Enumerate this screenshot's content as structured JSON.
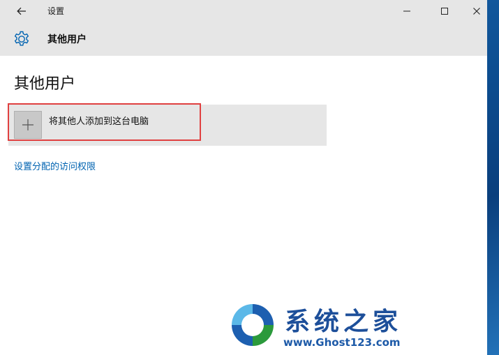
{
  "window": {
    "title": "设置"
  },
  "header": {
    "title": "其他用户"
  },
  "main": {
    "page_title": "其他用户",
    "add_user_label": "将其他人添加到这台电脑",
    "access_link": "设置分配的访问权限"
  },
  "watermark": {
    "brand": "系统之家",
    "url": "www.Ghost123.com"
  },
  "colors": {
    "titlebar": "#e6e6e6",
    "link": "#0063b1",
    "highlight": "#e04040",
    "desktop": "#0d4f92"
  },
  "icons": {
    "back": "arrow-left-icon",
    "minimize": "minimize-icon",
    "maximize": "maximize-icon",
    "close": "close-icon",
    "settings": "gear-icon",
    "add": "plus-icon"
  }
}
